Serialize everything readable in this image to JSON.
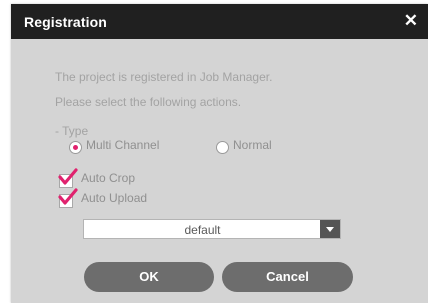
{
  "dialog": {
    "title": "Registration",
    "close_glyph": "✕"
  },
  "message": {
    "line1": "The project is registered in Job Manager.",
    "line2": "Please select the following actions."
  },
  "type": {
    "label": "- Type",
    "options": [
      {
        "label": "Multi Channel",
        "selected": true
      },
      {
        "label": "Normal",
        "selected": false
      }
    ]
  },
  "checkboxes": [
    {
      "label": "Auto Crop",
      "checked": true
    },
    {
      "label": "Auto Upload",
      "checked": true
    }
  ],
  "preset_select": {
    "value": "default"
  },
  "buttons": {
    "ok": "OK",
    "cancel": "Cancel"
  },
  "colors": {
    "accent": "#e0226e",
    "title_bar": "#202020",
    "dialog_bg": "#d4d4d4",
    "button_bg": "#6d6d6d"
  }
}
